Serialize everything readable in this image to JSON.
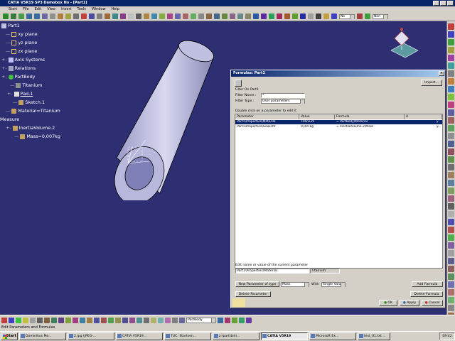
{
  "window": {
    "title": "CATIA V5R19 SP3 Demobox No - [Part1]"
  },
  "menu": [
    "Start",
    "File",
    "Edit",
    "View",
    "Insert",
    "Tools",
    "Window",
    "Help"
  ],
  "toolbar": {
    "zoom_value": "No",
    "render_value": "Non"
  },
  "tree": {
    "root": "Part1",
    "items": [
      "xy plane",
      "yz plane",
      "zx plane",
      "Axis Systems",
      "Relations",
      "PartBody",
      "Titanium",
      "Pad.1",
      "Sketch.1",
      "Material=Titanium",
      "Measure",
      "InertiaVolume.2",
      "Mass=0,007kg"
    ]
  },
  "dialog": {
    "title": "Formulas: Part1",
    "import_button": "Import...",
    "filter_on_label": "Filter On Part1",
    "filter_name_label": "Filter Name :",
    "filter_name_value": "*",
    "filter_type_label": "Filter Type :",
    "filter_type_value": "User parameters",
    "instruction": "Double click on a parameter to edit it",
    "columns": [
      "Parameter",
      "Value",
      "Formula",
      "A"
    ],
    "rows": [
      {
        "parameter": "Part1\\Properties\\Material",
        "value": "Titanium",
        "formula": "= PartBody\\Material",
        "active": "y"
      },
      {
        "parameter": "Part1\\Properties\\Gewicht",
        "value": "0,007kg",
        "formula": "= InertiaVolume.2\\Mass",
        "active": "y..."
      }
    ],
    "edit_label": "Edit name or value of the current parameter",
    "edit_name_value": "Part1\\Properties\\Material",
    "edit_value_value": "Titanium",
    "new_param_button": "New Parameter of type",
    "new_param_type": "Mass",
    "with_label": "With",
    "with_value": "Single Value",
    "add_formula_button": "Add Formula",
    "delete_param_button": "Delete Parameter",
    "delete_formula_button": "Delete Formula",
    "ok_button": "OK",
    "apply_button": "Apply",
    "cancel_button": "Cancel"
  },
  "bottom_toolbar": {
    "body_select": "PartBody"
  },
  "status": {
    "text": "Edit Parameters and Formulas"
  },
  "taskbar": {
    "start": "Start",
    "tasks": [
      "Dominikus Mo...",
      "2.jpg (JPEG-...",
      "CATIA V5R19...",
      "TUC: Startsen...",
      "z:\\part\\bin\\...",
      "CATIA V5R19",
      "Microsoft Ex...",
      "test_01.txt ..."
    ],
    "tray": "09:42",
    "active_index": 5
  },
  "colors": {
    "viewport": "#2e2e73",
    "tree_text": "#ffffff",
    "title_bar": "#0a246a",
    "selection": "#0a246a"
  }
}
